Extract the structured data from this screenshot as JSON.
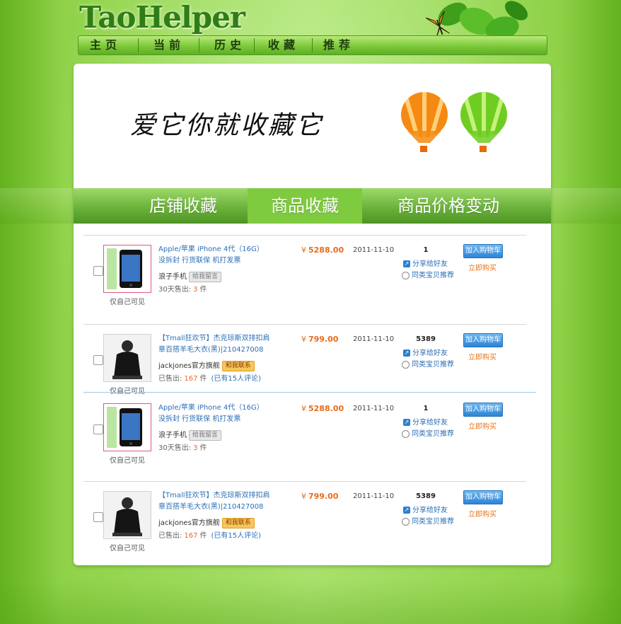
{
  "header": {
    "logo": "TaoHelper",
    "nav": [
      "主页",
      "当前",
      "历史",
      "收藏",
      "推荐"
    ]
  },
  "banner": {
    "slogan": "爱它你就收藏它"
  },
  "tabs": [
    "店铺收藏",
    "商品收藏",
    "商品价格变动"
  ],
  "active_tab": "商品收藏",
  "products": [
    {
      "title": "Apple/苹果 iPhone 4代（16G） 没拆封 行货联保 机打发票",
      "shop": "浪子手机",
      "contact": "给我留言",
      "contact_style": "gray",
      "sales_prefix": "30天售出:",
      "sales_num": "3",
      "sales_unit": "件",
      "reviews": "",
      "caption": "仅自己可见",
      "price_symbol": "¥",
      "price": "5288.00",
      "date": "2011-11-10",
      "count": "1",
      "share": "分享给好友",
      "recommend": "同类宝贝推荐",
      "cart_label": "加入购物车",
      "buy_label": "立即购买",
      "thumb_icon": "iphone-thumb"
    },
    {
      "title": "【Tmall狂欢节】杰克琼斯双排扣肩章百搭羊毛大衣(黑)|210427008",
      "shop": "jackjones官方旗舰",
      "contact": "和我联系",
      "contact_style": "orange",
      "sales_prefix": "已售出:",
      "sales_num": "167",
      "sales_unit": "件",
      "reviews": "(已有15人评论)",
      "caption": "仅自己可见",
      "price_symbol": "¥",
      "price": "799.00",
      "date": "2011-11-10",
      "count": "5389",
      "share": "分享给好友",
      "recommend": "同类宝贝推荐",
      "cart_label": "加入购物车",
      "buy_label": "立即购买",
      "thumb_icon": "coat-thumb"
    },
    {
      "title": "Apple/苹果 iPhone 4代（16G） 没拆封 行货联保 机打发票",
      "shop": "浪子手机",
      "contact": "给我留言",
      "contact_style": "gray",
      "sales_prefix": "30天售出:",
      "sales_num": "3",
      "sales_unit": "件",
      "reviews": "",
      "caption": "仅自己可见",
      "price_symbol": "¥",
      "price": "5288.00",
      "date": "2011-11-10",
      "count": "1",
      "share": "分享给好友",
      "recommend": "同类宝贝推荐",
      "cart_label": "加入购物车",
      "buy_label": "立即购买",
      "thumb_icon": "iphone-thumb"
    },
    {
      "title": "【Tmall狂欢节】杰克琼斯双排扣肩章百搭羊毛大衣(黑)|210427008",
      "shop": "jackjones官方旗舰",
      "contact": "和我联系",
      "contact_style": "orange",
      "sales_prefix": "已售出:",
      "sales_num": "167",
      "sales_unit": "件",
      "reviews": "(已有15人评论)",
      "caption": "仅自己可见",
      "price_symbol": "¥",
      "price": "799.00",
      "date": "2011-11-10",
      "count": "5389",
      "share": "分享给好友",
      "recommend": "同类宝贝推荐",
      "cart_label": "加入购物车",
      "buy_label": "立即购买",
      "thumb_icon": "coat-thumb"
    }
  ],
  "colors": {
    "background_green": "#8fd248",
    "tab_active": "#7fcb3f",
    "link_blue": "#2b6fb6",
    "price_orange": "#e96b1a",
    "cart_blue": "#2c84d6"
  }
}
